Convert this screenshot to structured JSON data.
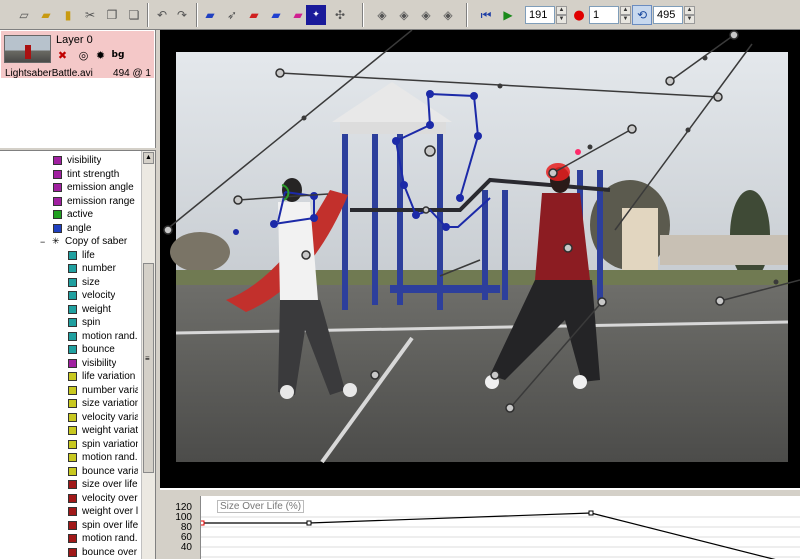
{
  "toolbar": {
    "start_frame": "191",
    "step_value": "1",
    "end_frame": "495",
    "icons": [
      "new-file-icon",
      "open-icon",
      "save-icon",
      "cut-icon",
      "copy-icon",
      "paste-icon",
      "undo-icon",
      "redo-icon",
      "layer-blue-icon",
      "pointer-icon",
      "layer-red-icon",
      "layer-blue2-icon",
      "layer-pink-icon",
      "starfield-icon",
      "particle-icon",
      "keyframe-prev-icon",
      "keyframe-add-icon",
      "keyframe-remove-icon",
      "keyframe-next-icon",
      "rewind-icon",
      "play-icon",
      "record-icon",
      "loop-icon"
    ],
    "colors": {
      "play": "#1a8a1a",
      "rewind": "#1f3fa6",
      "record": "#e00000",
      "loop_bg": "#c7d8ee"
    }
  },
  "layer": {
    "title": "Layer 0",
    "file": "LightsaberBattle.avi",
    "frame_info": "494 @ 1",
    "row_color": "#f4c8c8",
    "icons": [
      "remove-layer-icon",
      "target-icon",
      "sun-icon",
      "bg-icon"
    ],
    "bg_label": "bg"
  },
  "tree": {
    "top_items": [
      {
        "label": "visibility",
        "color": "#a020a0"
      },
      {
        "label": "tint strength",
        "color": "#a020a0"
      },
      {
        "label": "emission angle",
        "color": "#a020a0"
      },
      {
        "label": "emission range",
        "color": "#a020a0"
      },
      {
        "label": "active",
        "color": "#20a020"
      },
      {
        "label": "angle",
        "color": "#2040c0"
      }
    ],
    "group": {
      "label": "Copy of saber",
      "expander": "−",
      "icon": "✳"
    },
    "children": [
      {
        "label": "life",
        "color": "#20a0a0"
      },
      {
        "label": "number",
        "color": "#20a0a0"
      },
      {
        "label": "size",
        "color": "#20a0a0"
      },
      {
        "label": "velocity",
        "color": "#20a0a0"
      },
      {
        "label": "weight",
        "color": "#20a0a0"
      },
      {
        "label": "spin",
        "color": "#20a0a0"
      },
      {
        "label": "motion rand.",
        "color": "#20a0a0"
      },
      {
        "label": "bounce",
        "color": "#20a0a0"
      },
      {
        "label": "visibility",
        "color": "#a020a0"
      },
      {
        "label": "life variation",
        "color": "#c8c820"
      },
      {
        "label": "number variati",
        "color": "#c8c820"
      },
      {
        "label": "size variation",
        "color": "#c8c820"
      },
      {
        "label": "velocity variat",
        "color": "#c8c820"
      },
      {
        "label": "weight variatio",
        "color": "#c8c820"
      },
      {
        "label": "spin variation",
        "color": "#c8c820"
      },
      {
        "label": "motion rand. v",
        "color": "#c8c820"
      },
      {
        "label": "bounce variati",
        "color": "#c8c820"
      },
      {
        "label": "size over life",
        "color": "#a01818"
      },
      {
        "label": "velocity over li",
        "color": "#a01818"
      },
      {
        "label": "weight over lif",
        "color": "#a01818"
      },
      {
        "label": "spin over life",
        "color": "#a01818"
      },
      {
        "label": "motion rand. o",
        "color": "#a01818"
      },
      {
        "label": "bounce over li",
        "color": "#a01818"
      }
    ],
    "scroll_marker": "≡"
  },
  "graph": {
    "title": "Size Over Life (%)",
    "y_ticks": [
      "120",
      "100",
      "80",
      "60",
      "40"
    ]
  }
}
